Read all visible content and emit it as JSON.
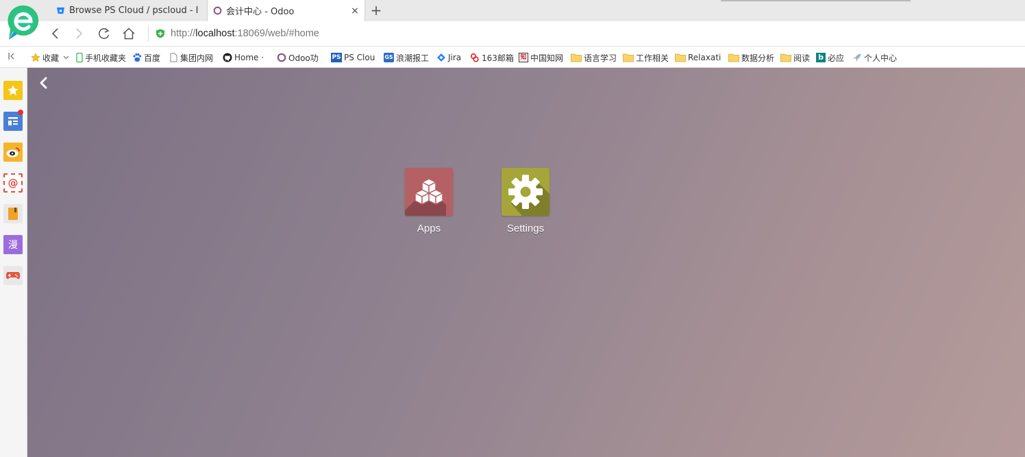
{
  "browser": {
    "tabs": [
      {
        "title": "Browse PS Cloud / pscloud - I",
        "favicon": "bitbucket-icon",
        "active": false
      },
      {
        "title": "会计中心 - Odoo",
        "favicon": "odoo-icon",
        "active": true
      }
    ],
    "new_tab_label": "+",
    "close_tab_label": "×",
    "url_prefix": "http://",
    "url_host": "localhost",
    "url_rest": ":18069/web/#home"
  },
  "bookmarks": [
    {
      "label": "收藏",
      "icon": "star-icon"
    },
    {
      "label": "手机收藏夹",
      "icon": "phone-icon"
    },
    {
      "label": "百度",
      "icon": "baidu-icon"
    },
    {
      "label": "集团内网",
      "icon": "page-icon"
    },
    {
      "label": "Home ·",
      "icon": "github-icon"
    },
    {
      "label": "Odoo功",
      "icon": "odoo-icon"
    },
    {
      "label": "PS Clou",
      "icon": "ps-icon"
    },
    {
      "label": "浪潮报工",
      "icon": "gs-icon"
    },
    {
      "label": "Jira",
      "icon": "jira-icon"
    },
    {
      "label": "163邮箱",
      "icon": "mail163-icon"
    },
    {
      "label": "中国知网",
      "icon": "cnki-icon"
    },
    {
      "label": "语言学习",
      "icon": "folder-icon"
    },
    {
      "label": "工作相关",
      "icon": "folder-icon"
    },
    {
      "label": "Relaxati",
      "icon": "folder-icon"
    },
    {
      "label": "数据分析",
      "icon": "folder-icon"
    },
    {
      "label": "阅读",
      "icon": "folder-icon"
    },
    {
      "label": "必应",
      "icon": "bing-icon"
    },
    {
      "label": "个人中心",
      "icon": "rocket-icon"
    }
  ],
  "sidebar": {
    "items": [
      {
        "name": "favorites",
        "icon": "star-icon",
        "color": "#f5c518"
      },
      {
        "name": "news",
        "icon": "news-icon",
        "color": "#4a7fd8",
        "badge": true
      },
      {
        "name": "weibo",
        "icon": "weibo-icon",
        "color": "#f5b52a"
      },
      {
        "name": "email",
        "icon": "at-mail-icon",
        "color": "#e44c3c"
      },
      {
        "name": "notes",
        "icon": "notebook-icon",
        "color": "#f0a22a"
      },
      {
        "name": "comics",
        "icon": "comic-icon",
        "color": "#9b6ddc",
        "text": "漫"
      },
      {
        "name": "games",
        "icon": "gamepad-icon",
        "color": "#e4553f"
      }
    ]
  },
  "odoo": {
    "apps": [
      {
        "label": "Apps",
        "icon": "cubes-icon",
        "color": "#b56064"
      },
      {
        "label": "Settings",
        "icon": "gear-icon",
        "color": "#a5a53a"
      }
    ]
  }
}
